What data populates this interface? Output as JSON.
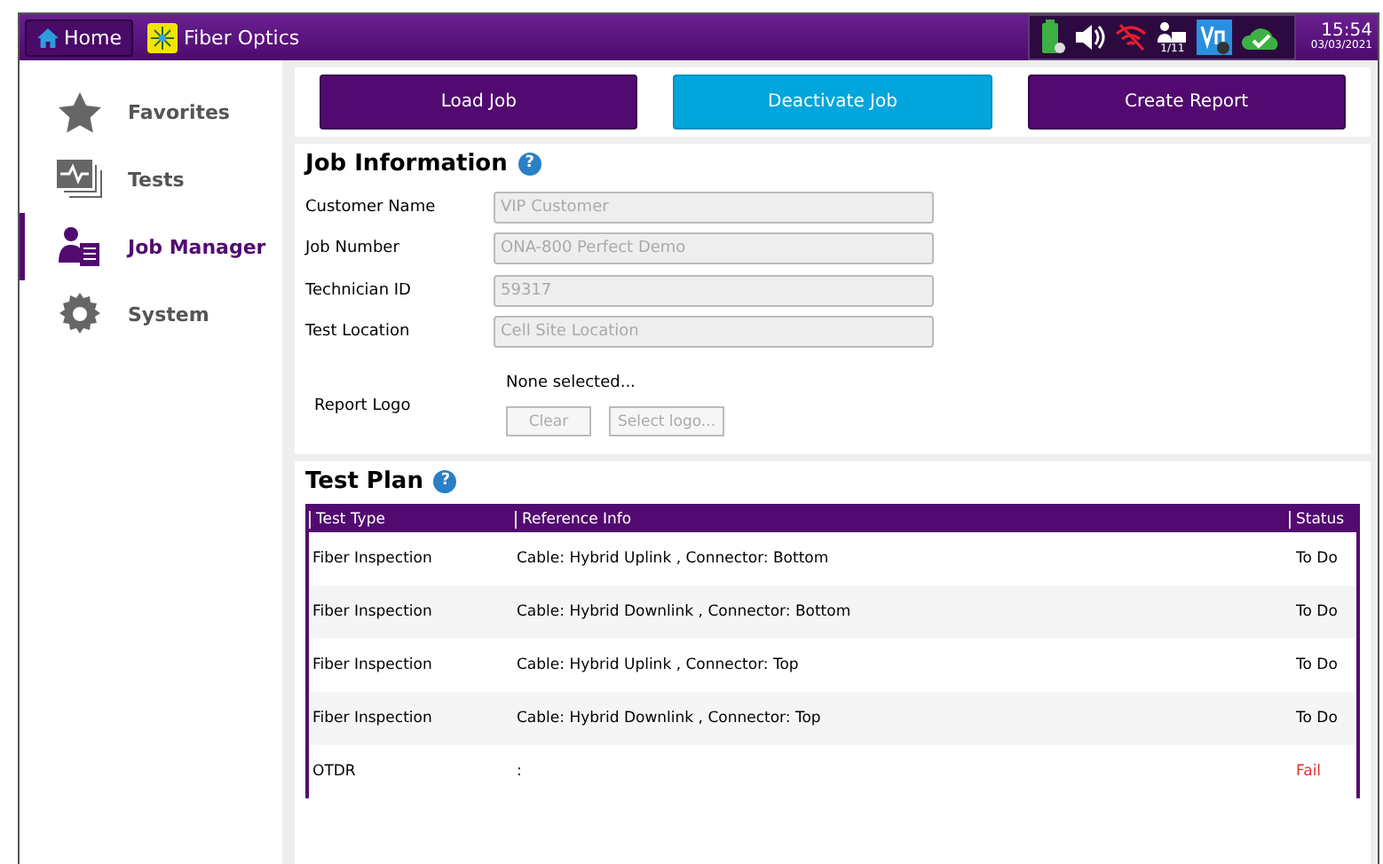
{
  "top_bar": {
    "home": "Home",
    "app": "Fiber Optics",
    "time": "15:54",
    "date": "03/03/2021",
    "port_count": "1/11"
  },
  "sidebar": {
    "items": [
      {
        "label": "Favorites",
        "kind": "star",
        "selected": false
      },
      {
        "label": "Tests",
        "kind": "tests",
        "selected": false
      },
      {
        "label": "Job Manager",
        "kind": "job",
        "selected": true
      },
      {
        "label": "System",
        "kind": "gear",
        "selected": false
      }
    ]
  },
  "actions": [
    {
      "label": "Load Job",
      "kind": "primary"
    },
    {
      "label": "Deactivate Job",
      "kind": "accent"
    },
    {
      "label": "Create Report",
      "kind": "primary"
    }
  ],
  "job_information": {
    "title": "Job Information",
    "help": "?",
    "fields": [
      {
        "label": "Customer Name",
        "value": "VIP Customer",
        "disabled": true
      },
      {
        "label": "Job Number",
        "value": "ONA-800 Perfect Demo",
        "disabled": true
      },
      {
        "label": "Technician ID",
        "value": "59317",
        "disabled": true
      },
      {
        "label": "Test Location",
        "value": "Cell Site Location",
        "disabled": true
      }
    ],
    "report_logo": {
      "label": "Report Logo",
      "status": "None selected...",
      "buttons": [
        {
          "label": "Clear",
          "disabled": true
        },
        {
          "label": "Select logo...",
          "disabled": true
        }
      ]
    }
  },
  "test_plan": {
    "title": "Test Plan",
    "help": "?",
    "columns": [
      "Test Type",
      "Reference Info",
      "Status"
    ],
    "rows": [
      {
        "test_type": "Fiber Inspection",
        "reference": "Cable: Hybrid Uplink , Connector: Bottom",
        "status": "To Do",
        "failed": false
      },
      {
        "test_type": "Fiber Inspection",
        "reference": "Cable: Hybrid Downlink , Connector: Bottom",
        "status": "To Do",
        "failed": false
      },
      {
        "test_type": "Fiber Inspection",
        "reference": "Cable: Hybrid Uplink , Connector: Top",
        "status": "To Do",
        "failed": false
      },
      {
        "test_type": "Fiber Inspection",
        "reference": "Cable: Hybrid Downlink , Connector: Top",
        "status": "To Do",
        "failed": false
      },
      {
        "test_type": "OTDR",
        "reference": ":",
        "status": "Fail",
        "failed": true
      }
    ]
  }
}
